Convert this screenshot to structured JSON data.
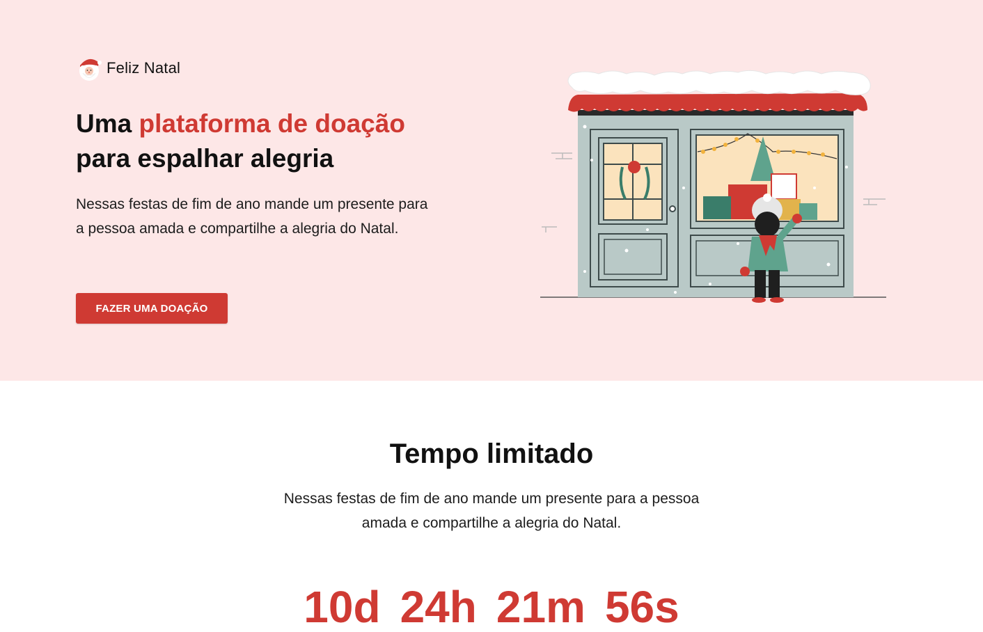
{
  "brand": {
    "name": "Feliz Natal",
    "icon": "santa-icon"
  },
  "hero": {
    "headline_before": "Uma ",
    "headline_accent": "plataforma de doação",
    "headline_after": "para espalhar alegria",
    "description": "Nessas festas de fim de ano mande um presente para a pessoa amada e compartilhe a alegria do Natal.",
    "cta_label": "FAZER UMA DOAÇÃO",
    "illustration": "christmas-shop-window-illustration"
  },
  "limited": {
    "title": "Tempo limitado",
    "description": "Nessas festas de fim de ano mande um presente para a pessoa amada e compartilhe a alegria do Natal.",
    "countdown": {
      "days": "10d",
      "hours": "24h",
      "minutes": "21m",
      "seconds": "56s"
    }
  },
  "colors": {
    "accent": "#cf3a33",
    "hero_bg": "#fde7e7",
    "text": "#111111"
  }
}
